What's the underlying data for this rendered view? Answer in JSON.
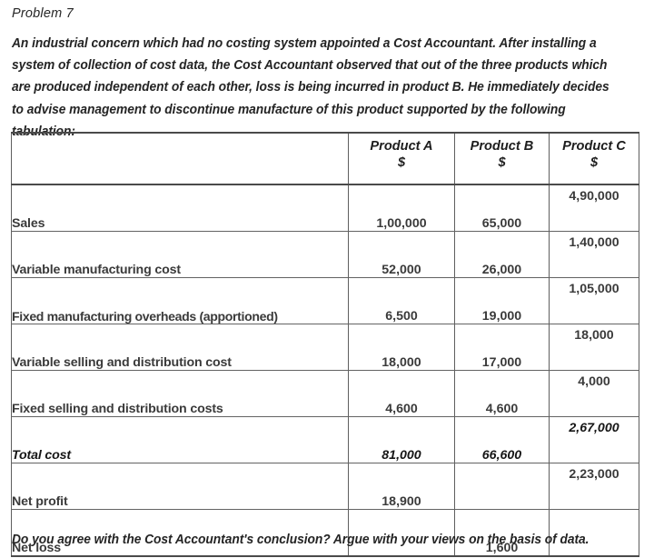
{
  "document": {
    "problem_title": "Problem 7",
    "intro_paragraph": "An industrial concern which had no costing system appointed a Cost Accountant. After installing a system of collection of cost data, the Cost Accountant observed that out of the three products which are produced independent of each other, loss is being incurred in product B. He immediately decides to advise management to discontinue manufacture of this product supported by the following tabulation:",
    "closing_question": "Do you agree with the Cost Accountant's conclusion? Argue with your views on the basis of data."
  },
  "table": {
    "header": {
      "label_column": "",
      "columns": [
        {
          "name": "Product A",
          "currency": "$"
        },
        {
          "name": "Product B",
          "currency": "$"
        },
        {
          "name": "Product C",
          "currency": "$"
        }
      ]
    },
    "rows": [
      {
        "label": "Sales",
        "a": "1,00,000",
        "b": "65,000",
        "c": "4,90,000",
        "emphasis": false
      },
      {
        "label": "Variable manufacturing cost",
        "a": "52,000",
        "b": "26,000",
        "c": "1,40,000",
        "emphasis": false
      },
      {
        "label": "Fixed manufacturing overheads (apportioned)",
        "a": "6,500",
        "b": "19,000",
        "c": "1,05,000",
        "emphasis": false
      },
      {
        "label": "Variable selling and distribution cost",
        "a": "18,000",
        "b": "17,000",
        "c": "18,000",
        "emphasis": false
      },
      {
        "label": "Fixed selling and distribution costs",
        "a": "4,600",
        "b": "4,600",
        "c": "4,000",
        "emphasis": false
      },
      {
        "label": "Total cost",
        "a": "81,000",
        "b": "66,600",
        "c": "2,67,000",
        "emphasis": true
      },
      {
        "label": "Net profit",
        "a": "18,900",
        "b": "",
        "c": "2,23,000",
        "emphasis": false
      },
      {
        "label": "Net loss",
        "a": "",
        "b": "1,600",
        "c": "",
        "emphasis": false
      }
    ]
  },
  "colors": {
    "text": "#2b2b2b",
    "label_text": "#3a3a3a",
    "border": "#5e5e5e",
    "background": "#ffffff"
  }
}
